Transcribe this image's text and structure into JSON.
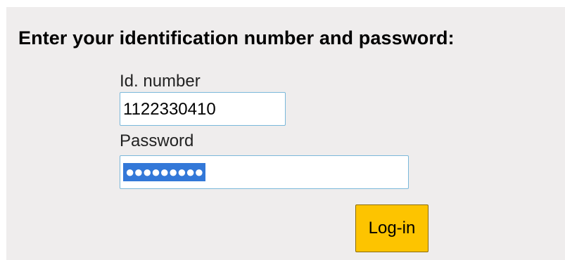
{
  "form": {
    "heading": "Enter your identification number and password:",
    "id_label": "Id. number",
    "id_value": "1122330410",
    "password_label": "Password",
    "password_masked": "●●●●●●●●●",
    "login_label": "Log-in"
  },
  "colors": {
    "panel_background": "#efeded",
    "input_border": "#7ab8da",
    "selection_highlight": "#3378d8",
    "login_button": "#fdc400"
  }
}
